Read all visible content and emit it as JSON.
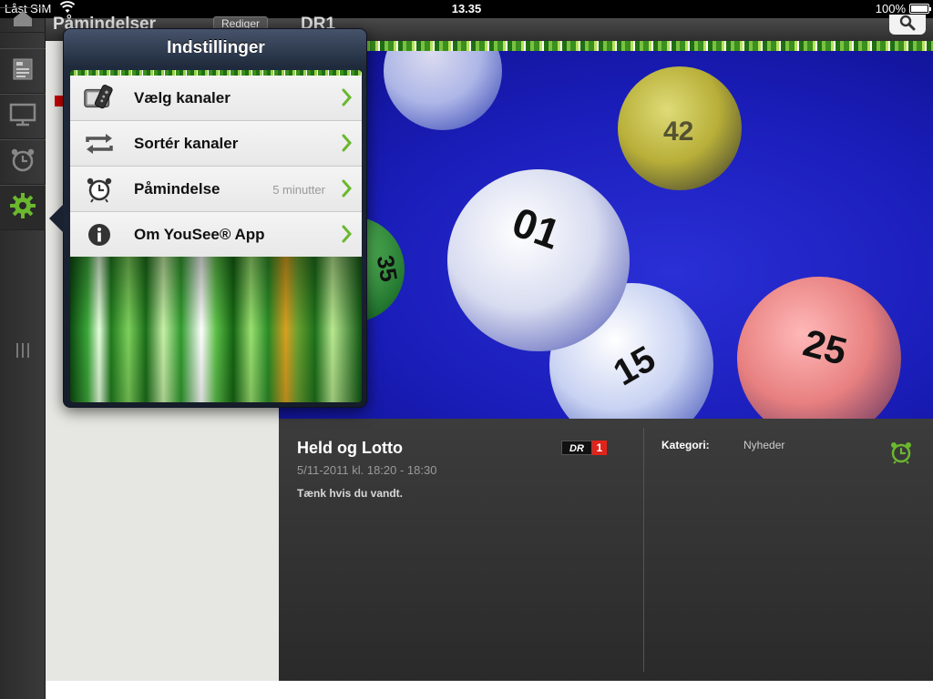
{
  "status_bar": {
    "carrier": "Låst SIM",
    "time": "13.35",
    "battery": "100%"
  },
  "header": {
    "left_title": "Påmindelser",
    "edit_label": "Rediger",
    "right_title": "DR1"
  },
  "popover": {
    "title": "Indstillinger",
    "items": [
      {
        "label": "Vælg kanaler",
        "value": "",
        "icon": "tv-remote-icon"
      },
      {
        "label": "Sortér kanaler",
        "value": "",
        "icon": "sort-arrows-icon"
      },
      {
        "label": "Påmindelse",
        "value": "5 minutter",
        "icon": "alarm-clock-icon"
      },
      {
        "label": "Om YouSee® App",
        "value": "",
        "icon": "info-icon"
      }
    ]
  },
  "program": {
    "title": "Held og Lotto",
    "time": "5/11-2011 kl. 18:20 - 18:30",
    "description": "Tænk hvis du vandt.",
    "channel_logo_text": "DR",
    "channel_logo_number": "1",
    "category_label": "Kategori:",
    "category_value": "Nyheder"
  },
  "hero": {
    "ball_numbers": [
      "01",
      "15",
      "25",
      "42",
      "35"
    ]
  },
  "colors": {
    "accent_green": "#6ab82e",
    "popover_navy": "#1f2a3c",
    "hero_blue": "#1a1db8",
    "dr_red": "#e2231a"
  }
}
